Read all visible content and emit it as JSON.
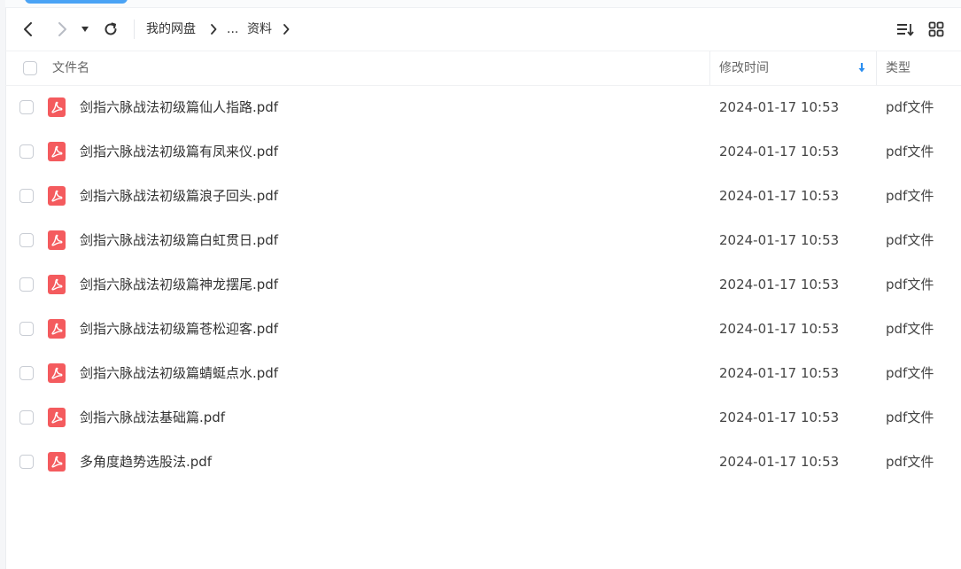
{
  "toolbar": {
    "breadcrumb": [
      {
        "label": "我的网盘"
      },
      {
        "label": "..."
      },
      {
        "label": "资料"
      }
    ]
  },
  "table": {
    "columns": {
      "name": "文件名",
      "modified": "修改时间",
      "type": "类型"
    },
    "rows": [
      {
        "name": "剑指六脉战法初级篇仙人指路.pdf",
        "modified": "2024-01-17 10:53",
        "type": "pdf文件"
      },
      {
        "name": "剑指六脉战法初级篇有凤来仪.pdf",
        "modified": "2024-01-17 10:53",
        "type": "pdf文件"
      },
      {
        "name": "剑指六脉战法初级篇浪子回头.pdf",
        "modified": "2024-01-17 10:53",
        "type": "pdf文件"
      },
      {
        "name": "剑指六脉战法初级篇白虹贯日.pdf",
        "modified": "2024-01-17 10:53",
        "type": "pdf文件"
      },
      {
        "name": "剑指六脉战法初级篇神龙摆尾.pdf",
        "modified": "2024-01-17 10:53",
        "type": "pdf文件"
      },
      {
        "name": "剑指六脉战法初级篇苍松迎客.pdf",
        "modified": "2024-01-17 10:53",
        "type": "pdf文件"
      },
      {
        "name": "剑指六脉战法初级篇蜻蜓点水.pdf",
        "modified": "2024-01-17 10:53",
        "type": "pdf文件"
      },
      {
        "name": "剑指六脉战法基础篇.pdf",
        "modified": "2024-01-17 10:53",
        "type": "pdf文件"
      },
      {
        "name": "多角度趋势选股法.pdf",
        "modified": "2024-01-17 10:53",
        "type": "pdf文件"
      }
    ]
  },
  "colors": {
    "pdf_icon": "#f45b5e",
    "sort_arrow": "#2b8ef0",
    "top_pill": "#4aa3f5"
  },
  "icons": {
    "back": "chevron-left-icon",
    "forward": "chevron-right-icon",
    "history_dropdown": "caret-down-icon",
    "refresh": "refresh-icon",
    "sort": "sort-list-icon",
    "grid_view": "grid-view-icon",
    "file": "pdf-file-icon",
    "sort_indicator": "arrow-down-icon"
  }
}
